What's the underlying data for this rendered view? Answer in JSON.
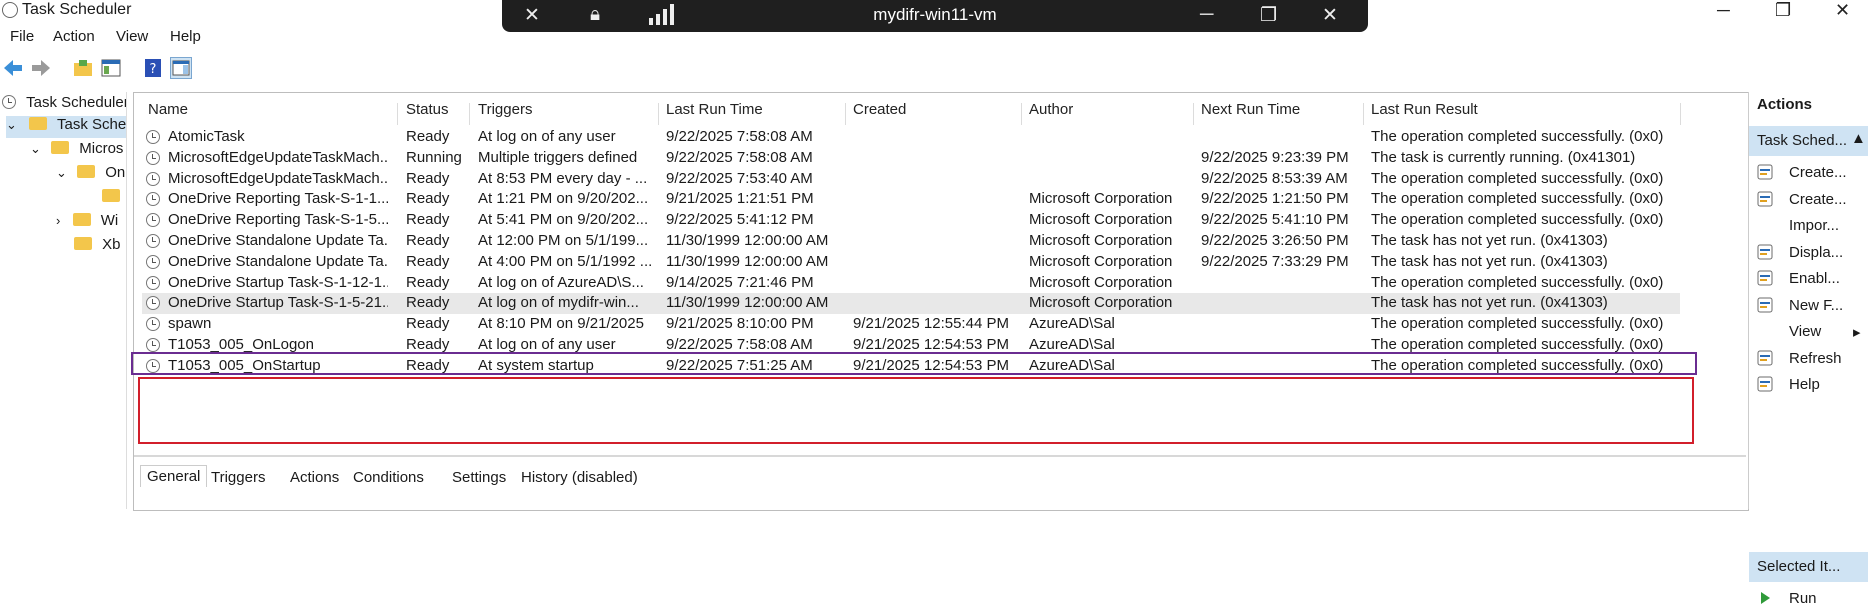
{
  "window": {
    "title": "Task Scheduler"
  },
  "remote_bar": {
    "title": "mydifr-win11-vm",
    "pin_icon": "pin-icon",
    "lock_icon": "lock-icon",
    "signal_icon": "signal-icon"
  },
  "menu": {
    "file": "File",
    "action": "Action",
    "view": "View",
    "help": "Help"
  },
  "tree": {
    "root": "Task Scheduler",
    "library": "Task Sched",
    "microsoft": "Micros",
    "on": "On",
    "wi": "Wi",
    "xb": "Xb"
  },
  "table": {
    "headers": [
      "Name",
      "Status",
      "Triggers",
      "Last Run Time",
      "Created",
      "Author",
      "Next Run Time",
      "Last Run Result"
    ],
    "rows": [
      [
        "AtomicTask",
        "Ready",
        "At log on of any user",
        "9/22/2025 7:58:08 AM",
        "",
        "",
        "",
        "The operation completed successfully. (0x0)"
      ],
      [
        "MicrosoftEdgeUpdateTaskMach...",
        "Running",
        "Multiple triggers defined",
        "9/22/2025 7:58:08 AM",
        "",
        "",
        "9/22/2025 9:23:39 PM",
        "The task is currently running. (0x41301)"
      ],
      [
        "MicrosoftEdgeUpdateTaskMach...",
        "Ready",
        "At 8:53 PM every day - ...",
        "9/22/2025 7:53:40 AM",
        "",
        "",
        "9/22/2025 8:53:39 AM",
        "The operation completed successfully. (0x0)"
      ],
      [
        "OneDrive Reporting Task-S-1-1...",
        "Ready",
        "At 1:21 PM on 9/20/202...",
        "9/21/2025 1:21:51 PM",
        "",
        "Microsoft Corporation",
        "9/22/2025 1:21:50 PM",
        "The operation completed successfully. (0x0)"
      ],
      [
        "OneDrive Reporting Task-S-1-5...",
        "Ready",
        "At 5:41 PM on 9/20/202...",
        "9/22/2025 5:41:12 PM",
        "",
        "Microsoft Corporation",
        "9/22/2025 5:41:10 PM",
        "The operation completed successfully. (0x0)"
      ],
      [
        "OneDrive Standalone Update Ta...",
        "Ready",
        "At 12:00 PM on 5/1/199...",
        "11/30/1999 12:00:00 AM",
        "",
        "Microsoft Corporation",
        "9/22/2025 3:26:50 PM",
        "The task has not yet run. (0x41303)"
      ],
      [
        "OneDrive Standalone Update Ta...",
        "Ready",
        "At 4:00 PM on 5/1/1992 ...",
        "11/30/1999 12:00:00 AM",
        "",
        "Microsoft Corporation",
        "9/22/2025 7:33:29 PM",
        "The task has not yet run. (0x41303)"
      ],
      [
        "OneDrive Startup Task-S-1-12-1...",
        "Ready",
        "At log on of AzureAD\\S...",
        "9/14/2025 7:21:46 PM",
        "",
        "Microsoft Corporation",
        "",
        "The operation completed successfully. (0x0)"
      ],
      [
        "OneDrive Startup Task-S-1-5-21...",
        "Ready",
        "At log on of mydifr-win...",
        "11/30/1999 12:00:00 AM",
        "",
        "Microsoft Corporation",
        "",
        "The task has not yet run. (0x41303)"
      ],
      [
        "spawn",
        "Ready",
        "At 8:10 PM on 9/21/2025",
        "9/21/2025 8:10:00 PM",
        "9/21/2025 12:55:44 PM",
        "AzureAD\\Sal",
        "",
        "The operation completed successfully. (0x0)"
      ],
      [
        "T1053_005_OnLogon",
        "Ready",
        "At log on of any user",
        "9/22/2025 7:58:08 AM",
        "9/21/2025 12:54:53 PM",
        "AzureAD\\Sal",
        "",
        "The operation completed successfully. (0x0)"
      ],
      [
        "T1053_005_OnStartup",
        "Ready",
        "At system startup",
        "9/22/2025 7:51:25 AM",
        "9/21/2025 12:54:53 PM",
        "AzureAD\\Sal",
        "",
        "The operation completed successfully. (0x0)"
      ]
    ]
  },
  "detail_tabs": [
    "General",
    "Triggers",
    "Actions",
    "Conditions",
    "Settings",
    "History (disabled)"
  ],
  "actions_pane": {
    "header": "Actions",
    "section1": "Task Sched...",
    "items": [
      {
        "label": "Create...",
        "icon": "create-basic-task-icon"
      },
      {
        "label": "Create...",
        "icon": "create-task-icon"
      },
      {
        "label": "Impor...",
        "icon": ""
      },
      {
        "label": "Displa...",
        "icon": "display-running-tasks-icon"
      },
      {
        "label": "Enabl...",
        "icon": "enable-history-icon"
      },
      {
        "label": "New F...",
        "icon": "new-folder-icon"
      },
      {
        "label": "View",
        "icon": ""
      },
      {
        "label": "Refresh",
        "icon": "refresh-icon"
      },
      {
        "label": "Help",
        "icon": "help-icon"
      }
    ],
    "section2": "Selected It...",
    "run": "Run"
  },
  "colors": {
    "purple_box": "#6a2c91",
    "red_box": "#d21f2b",
    "section_bg": "#cfe3f3"
  }
}
